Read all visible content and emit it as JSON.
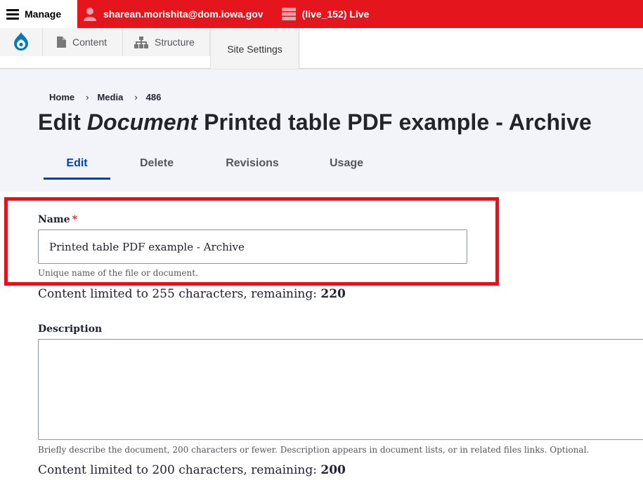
{
  "toolbar": {
    "manage_label": "Manage",
    "user_label": "sharean.morishita@dom.iowa.gov",
    "environment_label": "(live_152) Live"
  },
  "tray": {
    "content_label": "Content",
    "structure_label": "Structure",
    "site_settings_label": "Site Settings"
  },
  "breadcrumb": {
    "items": [
      "Home",
      "Media",
      "486"
    ],
    "separator": "›"
  },
  "page": {
    "title_prefix": "Edit",
    "title_type": "Document",
    "title_name": "Printed table PDF example - Archive"
  },
  "tabs": [
    "Edit",
    "Delete",
    "Revisions",
    "Usage"
  ],
  "form": {
    "name": {
      "label": "Name",
      "required_mark": "*",
      "value": "Printed table PDF example - Archive",
      "description": "Unique name of the file or document.",
      "counter_text": "Content limited to 255 characters, remaining: ",
      "counter_value": "220"
    },
    "description": {
      "label": "Description",
      "value": "",
      "description": "Briefly describe the document, 200 characters or fewer. Description appears in document lists, or in related files links. Optional.",
      "counter_text": "Content limited to 200 characters, remaining: ",
      "counter_value": "200"
    }
  },
  "colors": {
    "toolbar_red": "#e5151d",
    "active_tab_blue": "#003ecc",
    "highlight_red": "#e8111a",
    "drupal_blue": "#0678be"
  },
  "icons": [
    "hamburger-icon",
    "user-icon",
    "server-icon",
    "drupal-logo-icon",
    "document-icon",
    "sitemap-icon"
  ]
}
